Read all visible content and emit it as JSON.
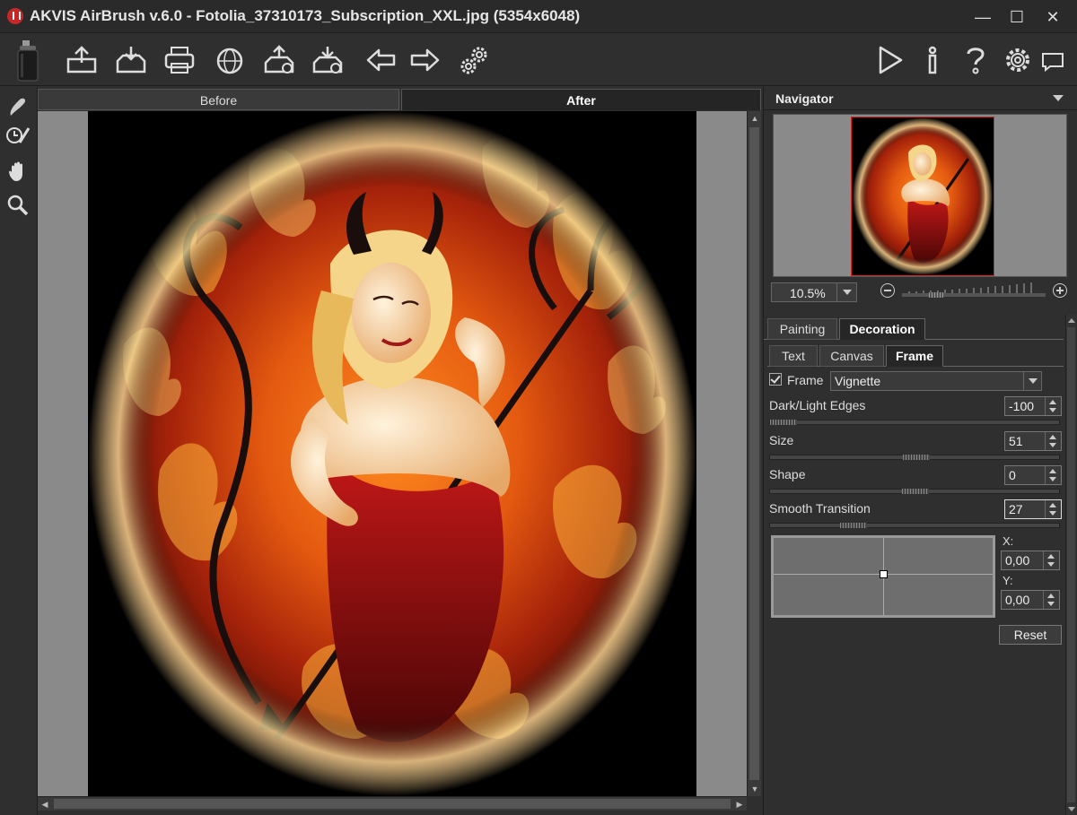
{
  "window": {
    "title": "AKVIS AirBrush v.6.0 - Fotolia_37310173_Subscription_XXL.jpg (5354x6048)",
    "controls": {
      "minimize": "—",
      "maximize": "☐",
      "close": "✕"
    }
  },
  "toolbar": {
    "left": [
      "open-icon",
      "save-icon",
      "print-icon",
      "share-web-icon",
      "batch-icon",
      "import-preset-icon",
      "undo-arrow-icon",
      "redo-arrow-icon",
      "settings-gears-icon"
    ],
    "right": [
      "run-icon",
      "info-icon",
      "help-icon",
      "preferences-icon",
      "hints-icon"
    ]
  },
  "tools": [
    "airbrush-icon",
    "history-brush-icon",
    "hand-icon",
    "zoom-icon"
  ],
  "view_tabs": {
    "before": "Before",
    "after": "After"
  },
  "navigator": {
    "title": "Navigator",
    "zoom": "10.5%"
  },
  "panel_tabs": {
    "painting": "Painting",
    "decoration": "Decoration"
  },
  "sub_tabs": {
    "text": "Text",
    "canvas": "Canvas",
    "frame": "Frame"
  },
  "frame": {
    "checkbox_label": "Frame",
    "type": "Vignette",
    "dark_light_label": "Dark/Light Edges",
    "dark_light_value": "-100",
    "size_label": "Size",
    "size_value": "51",
    "shape_label": "Shape",
    "shape_value": "0",
    "smooth_label": "Smooth Transition",
    "smooth_value": "27",
    "x_label": "X:",
    "x_value": "0,00",
    "y_label": "Y:",
    "y_value": "0,00",
    "reset_label": "Reset"
  },
  "colors": {
    "accent_red": "#c62828",
    "bg": "#2f2f2f",
    "panel": "#3a3a3a"
  }
}
